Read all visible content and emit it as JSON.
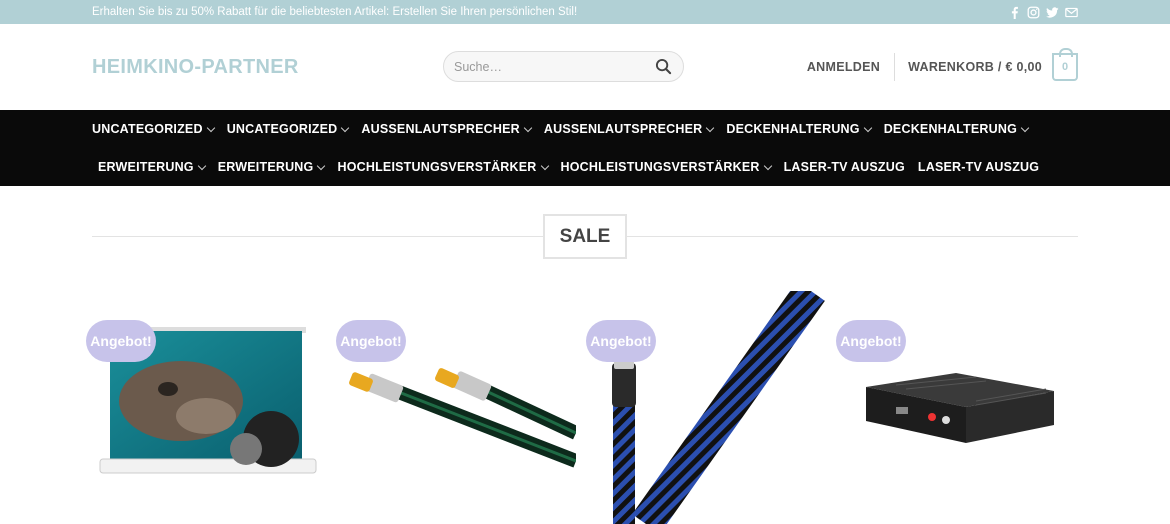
{
  "topbar": {
    "promo": "Erhalten Sie bis zu 50% Rabatt für die beliebtesten Artikel: Erstellen Sie Ihren persönlichen Stil!",
    "social": [
      "facebook-icon",
      "instagram-icon",
      "twitter-icon",
      "email-icon"
    ]
  },
  "header": {
    "logo": "HEIMKINO-PARTNER",
    "search_placeholder": "Suche…",
    "login": "ANMELDEN",
    "cart_label": "WARENKORB / € 0,00",
    "cart_count": "0"
  },
  "nav": {
    "row1": [
      "UNCATEGORIZED",
      "UNCATEGORIZED",
      "AUSSENLAUTSPRECHER",
      "AUSSENLAUTSPRECHER",
      "DECKENHALTERUNG",
      "DECKENHALTERUNG"
    ],
    "row2": [
      "ERWEITERUNG",
      "ERWEITERUNG",
      "HOCHLEISTUNGSVERSTÄRKER",
      "HOCHLEISTUNGSVERSTÄRKER",
      "LASER-TV AUSZUG",
      "LASER-TV AUSZUG"
    ]
  },
  "section": {
    "title": "SALE"
  },
  "products": [
    {
      "badge": "Angebot!",
      "image": "projector-screen-image"
    },
    {
      "badge": "Angebot!",
      "image": "antenna-cable-image"
    },
    {
      "badge": "Angebot!",
      "image": "ethernet-cable-image"
    },
    {
      "badge": "Angebot!",
      "image": "hdmi-extractor-image"
    }
  ],
  "colors": {
    "accent": "#b1d0d5",
    "badge": "#c7c3ea",
    "nav_bg": "#0a0a0a"
  }
}
